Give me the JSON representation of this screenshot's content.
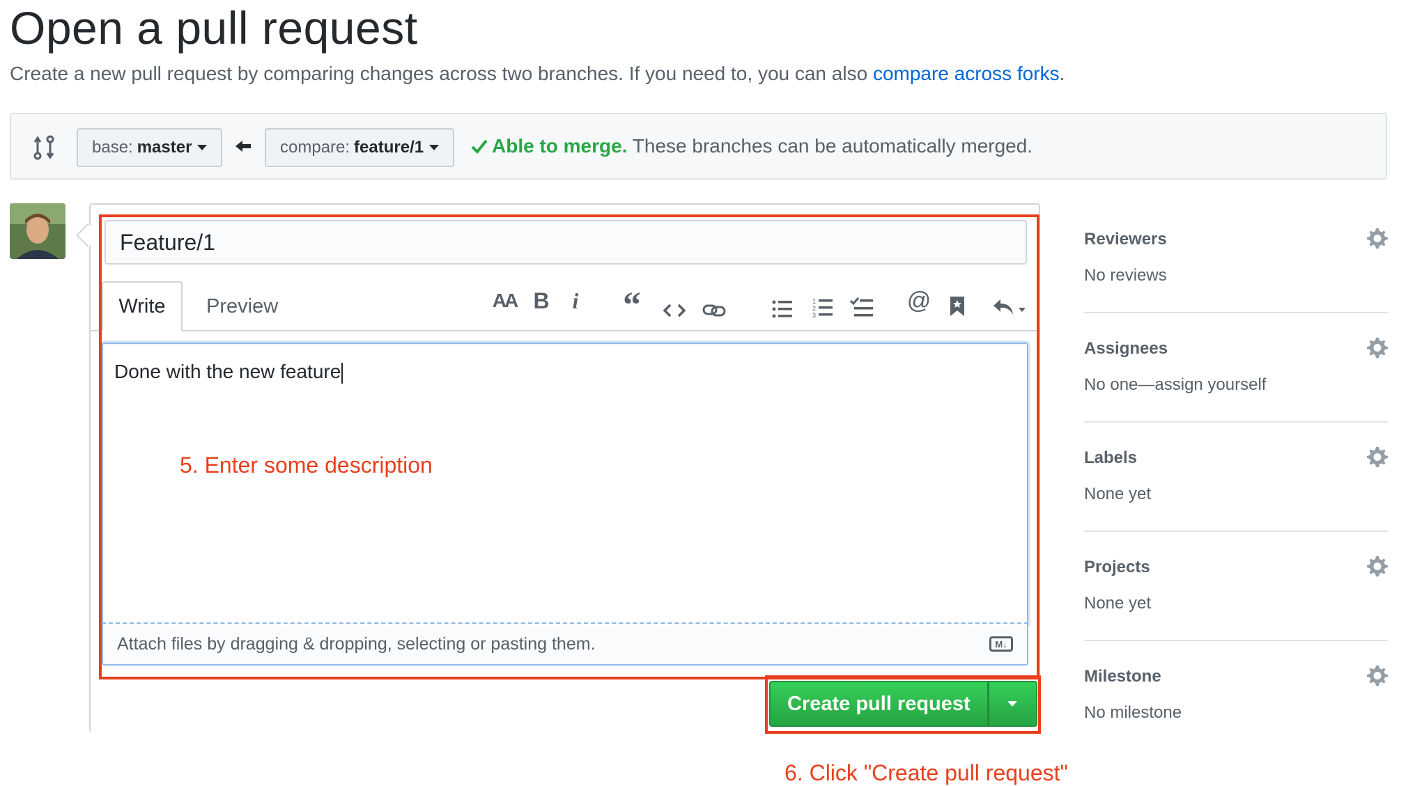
{
  "page": {
    "title": "Open a pull request",
    "subtitle": "Create a new pull request by comparing changes across two branches. If you need to, you can also ",
    "subtitle_link": "compare across forks",
    "subtitle_end": "."
  },
  "compare_bar": {
    "base_label": "base:",
    "base_branch": "master",
    "compare_label": "compare:",
    "compare_branch": "feature/1",
    "merge_ok": "Able to merge.",
    "merge_text": "These branches can be automatically merged."
  },
  "form": {
    "title_value": "Feature/1",
    "tab_write": "Write",
    "tab_preview": "Preview",
    "toolbar": [
      "header-icon",
      "bold-icon",
      "italic-icon",
      "quote-icon",
      "code-icon",
      "link-icon",
      "bullet-list-icon",
      "numbered-list-icon",
      "task-list-icon",
      "mention-icon",
      "saved-reply-icon",
      "reply-icon"
    ],
    "body_text": "Done with the new feature",
    "attach_text": "Attach files by dragging & dropping, selecting or pasting them.",
    "md_badge": "M↓",
    "submit_label": "Create pull request"
  },
  "annotations": {
    "step5": "5. Enter some description",
    "step6": "6. Click \"Create pull request\"",
    "color": "#e8401c"
  },
  "sidebar": {
    "sections": [
      {
        "title": "Reviewers",
        "value": "No reviews"
      },
      {
        "title": "Assignees",
        "value": "No one—assign yourself"
      },
      {
        "title": "Labels",
        "value": "None yet"
      },
      {
        "title": "Projects",
        "value": "None yet"
      },
      {
        "title": "Milestone",
        "value": "No milestone"
      }
    ]
  },
  "colors": {
    "link": "#0366d6",
    "success": "#28a745",
    "annotation": "#e8401c"
  }
}
